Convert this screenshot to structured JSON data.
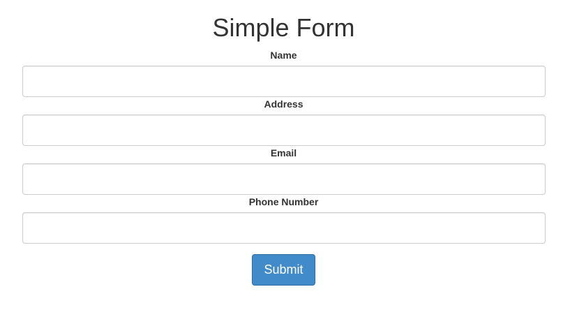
{
  "form": {
    "title": "Simple Form",
    "fields": [
      {
        "label": "Name",
        "value": "",
        "placeholder": ""
      },
      {
        "label": "Address",
        "value": "",
        "placeholder": ""
      },
      {
        "label": "Email",
        "value": "",
        "placeholder": ""
      },
      {
        "label": "Phone Number",
        "value": "",
        "placeholder": ""
      }
    ],
    "submit_label": "Submit",
    "colors": {
      "button_background": "#428bca",
      "button_border": "#2e6da4",
      "input_border": "#cccccc",
      "text": "#333333"
    }
  }
}
